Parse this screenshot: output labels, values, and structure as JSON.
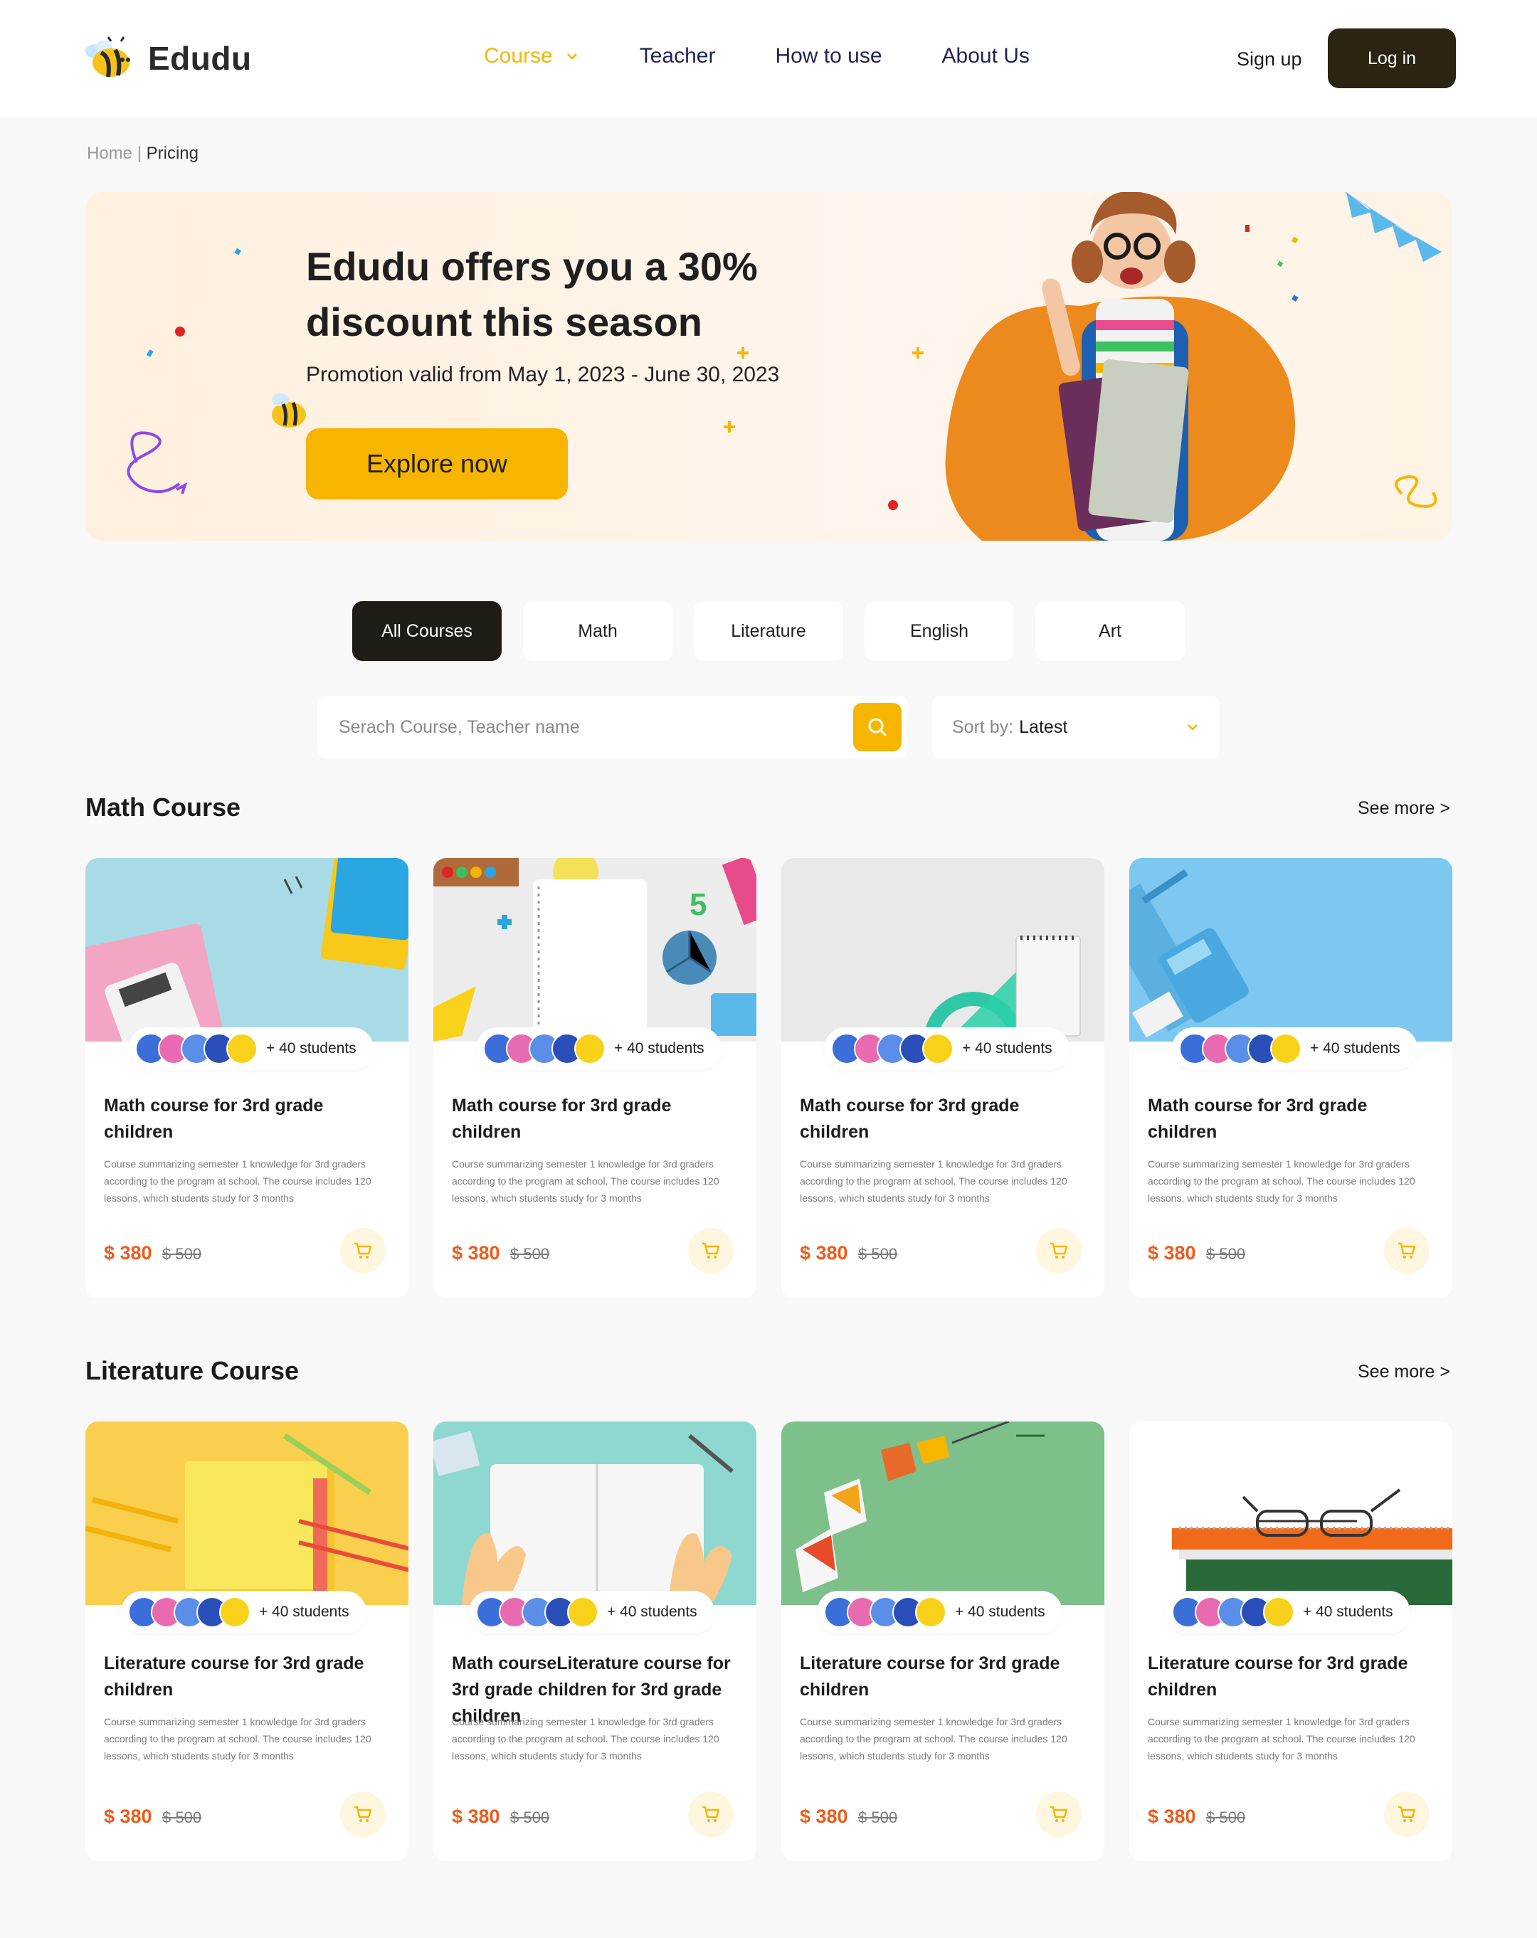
{
  "header": {
    "brand": "Edudu",
    "nav": [
      {
        "label": "Course",
        "active": true
      },
      {
        "label": "Teacher"
      },
      {
        "label": "How to use"
      },
      {
        "label": "About Us"
      }
    ],
    "signup": "Sign up",
    "login": "Log in"
  },
  "breadcrumb": {
    "home": "Home",
    "separator": "|",
    "current": "Pricing"
  },
  "banner": {
    "title": "Edudu offers you a 30% discount this season",
    "subtitle": "Promotion valid from May 1, 2023 - June 30, 2023",
    "cta": "Explore now"
  },
  "filters": [
    "All Courses",
    "Math",
    "Literature",
    "English",
    "Art"
  ],
  "search": {
    "placeholder": "Serach Course, Teacher name"
  },
  "sort": {
    "label": "Sort by:",
    "value": "Latest"
  },
  "sections": [
    {
      "title": "Math Course",
      "see_more": "See more >",
      "cards": [
        {
          "title": "Math course for 3rd grade children",
          "desc": "Course summarizing semester 1 knowledge for 3rd graders according to the program at school. The course includes 120 lessons, which students study for 3 months",
          "students": "+ 40 students",
          "price": "$ 380",
          "old_price": "$ 500"
        },
        {
          "title": "Math course for 3rd grade children",
          "desc": "Course summarizing semester 1 knowledge for 3rd graders according to the program at school. The course includes 120 lessons, which students study for 3 months",
          "students": "+ 40 students",
          "price": "$ 380",
          "old_price": "$ 500"
        },
        {
          "title": "Math course for 3rd grade children",
          "desc": "Course summarizing semester 1 knowledge for 3rd graders according to the program at school. The course includes 120 lessons, which students study for 3 months",
          "students": "+ 40 students",
          "price": "$ 380",
          "old_price": "$ 500"
        },
        {
          "title": "Math course for 3rd grade children",
          "desc": "Course summarizing semester 1 knowledge for 3rd graders according to the program at school. The course includes 120 lessons, which students study for 3 months",
          "students": "+ 40 students",
          "price": "$ 380",
          "old_price": "$ 500"
        }
      ]
    },
    {
      "title": "Literature Course",
      "see_more": "See more >",
      "cards": [
        {
          "title": "Literature course for 3rd grade children",
          "desc": "Course summarizing semester 1 knowledge for 3rd graders according to the program at school. The course includes 120 lessons, which students study for 3 months",
          "students": "+ 40 students",
          "price": "$ 380",
          "old_price": "$ 500"
        },
        {
          "title": "Math courseLiterature course for 3rd grade children for 3rd grade children",
          "desc": "Course summarizing semester 1 knowledge for 3rd graders according to the program at school. The course includes 120 lessons, which students study for 3 months",
          "students": "+ 40 students",
          "price": "$ 380",
          "old_price": "$ 500"
        },
        {
          "title": "Literature course for 3rd grade children",
          "desc": "Course summarizing semester 1 knowledge for 3rd graders according to the program at school. The course includes 120 lessons, which students study for 3 months",
          "students": "+ 40 students",
          "price": "$ 380",
          "old_price": "$ 500"
        },
        {
          "title": "Literature course for 3rd grade children",
          "desc": "Course summarizing semester 1 knowledge for 3rd graders according to the program at school. The course includes 120 lessons, which students study for 3 months",
          "students": "+ 40 students",
          "price": "$ 380",
          "old_price": "$ 500"
        }
      ]
    }
  ],
  "colors": {
    "accent": "#f8b500",
    "dark": "#2b2412",
    "price": "#f05a1a",
    "banner_bg": "#fff0df"
  },
  "icons": {
    "search": "search-icon",
    "cart": "cart-icon",
    "chevron": "chevron-down-icon",
    "logo": "bee-logo-icon"
  }
}
